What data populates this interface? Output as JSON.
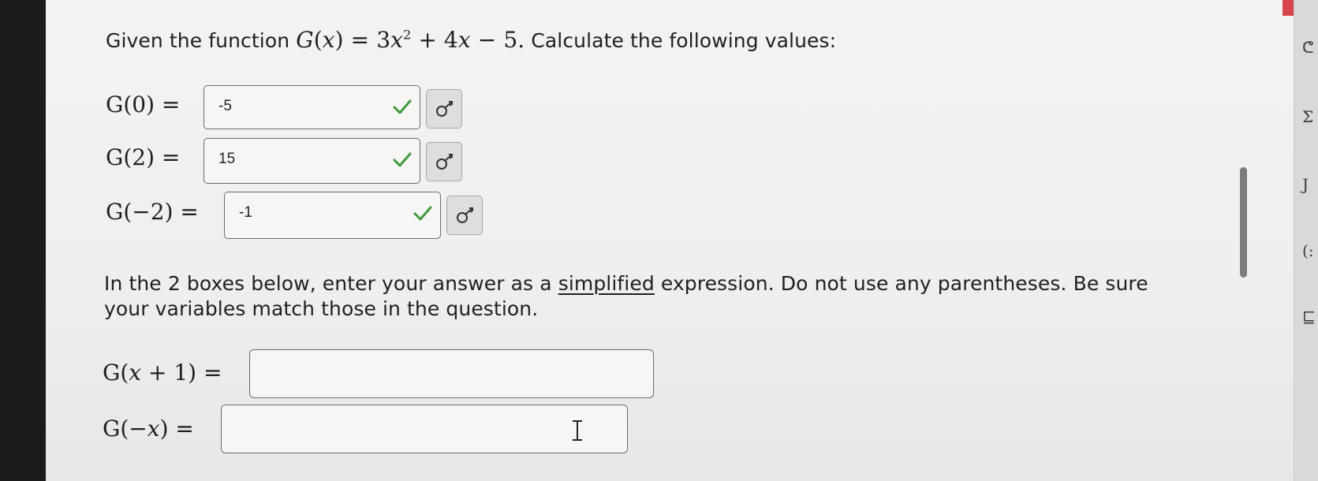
{
  "question": {
    "intro_before": "Given the function",
    "function_name": "G",
    "function_var": "x",
    "function_expr_a": "3",
    "function_expr_var": "x",
    "function_expr_exp": "2",
    "function_expr_rest": "+ 4",
    "function_expr_var2": "x",
    "function_expr_tail": "− 5.",
    "intro_after": "Calculate the following values:"
  },
  "values": [
    {
      "label_prefix": "G(0) =",
      "answer": "-5"
    },
    {
      "label_prefix": "G(2) =",
      "answer": "15"
    },
    {
      "label_prefix": "G(−2) =",
      "answer": "-1"
    }
  ],
  "instructions": {
    "before_underline": "In the 2 boxes below, enter your answer as a",
    "underlined": "simplified",
    "after_underline": "expression. Do not use any parentheses. Be sure",
    "line2": "your variables match those in the question."
  },
  "expressions": [
    {
      "label_g": "G(",
      "label_var": "x",
      "label_rest": " + 1) =",
      "value": ""
    },
    {
      "label_g": "G(−",
      "label_var": "x",
      "label_rest": ") =",
      "value": ""
    }
  ],
  "side_glyphs": [
    "ᕦ",
    "Σ",
    "J",
    "(:",
    "⊑"
  ],
  "colors": {
    "check": "#3f9a3a",
    "accent_red": "#d9454e"
  }
}
